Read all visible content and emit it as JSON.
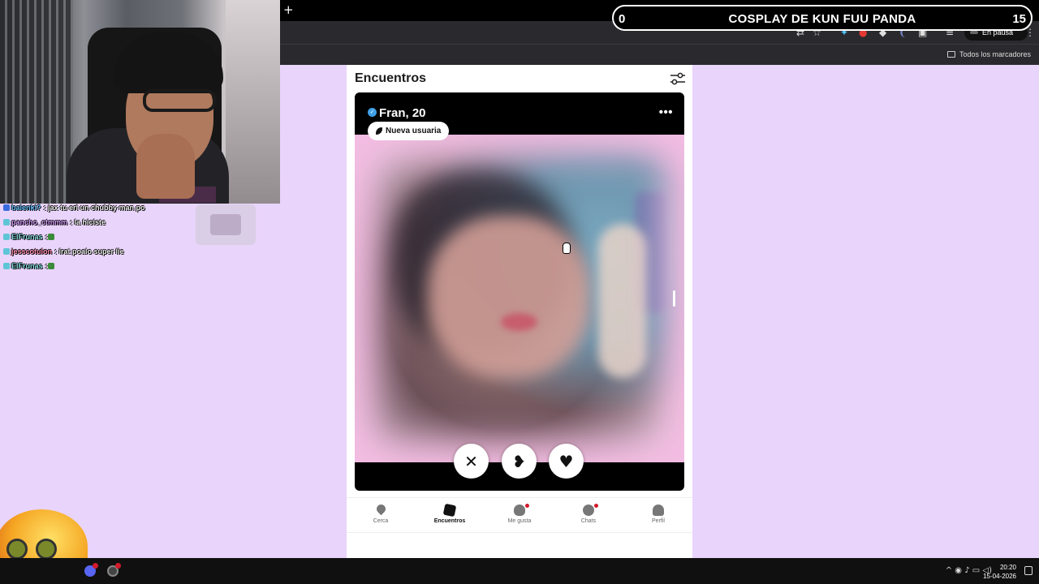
{
  "overlay": {
    "counter_left": "0",
    "title": "COSPLAY DE KUN FUU PANDA",
    "counter_right": "15"
  },
  "browser": {
    "new_tab_glyph": "+",
    "window_controls": "— ▢ ✕",
    "pause_label": "En pausa",
    "bookmarks_label": "Todos los marcadores"
  },
  "chat": {
    "messages": [
      {
        "user": "balenki?",
        "text": ": jax tu eri un chubby man po",
        "user_color": "#6ac3ff",
        "badge": "blue"
      },
      {
        "user": "pancho_ctmmm",
        "text": ": la hiciste",
        "user_color": "#d9a2ff",
        "badge": "cyan"
      },
      {
        "user": "ElFrunas",
        "text": ":",
        "user_color": "#8ee0e6",
        "badge": "cyan"
      },
      {
        "user": "jesscotulon",
        "text": ": irat poalo super lie",
        "user_color": "#ff8fb3",
        "badge": "cyan"
      },
      {
        "user": "ElFrunas",
        "text": ":",
        "user_color": "#8ee0e6",
        "badge": "cyan"
      }
    ]
  },
  "app": {
    "title": "Encuentros",
    "profile": {
      "name_age": "Fran, 20",
      "badge": "Nueva usuaria"
    },
    "actions": {
      "pass": "✕",
      "crush": "❥",
      "like": "♥"
    },
    "nav": [
      {
        "label": "Cerca",
        "icon": "location-pin-icon",
        "active": false
      },
      {
        "label": "Encuentros",
        "icon": "cards-icon",
        "active": true
      },
      {
        "label": "Me gusta",
        "icon": "heart-chat-icon",
        "active": false
      },
      {
        "label": "Chats",
        "icon": "chat-bubble-icon",
        "active": false
      },
      {
        "label": "Perfil",
        "icon": "person-icon",
        "active": false
      }
    ],
    "accent": "#3fa0e8",
    "page_background": "#e9d4fb"
  },
  "taskbar": {
    "time": "20:20",
    "date": "15-04-2026",
    "tray_glyphs": "^ ◉ ♪ ▭ ◁)"
  }
}
